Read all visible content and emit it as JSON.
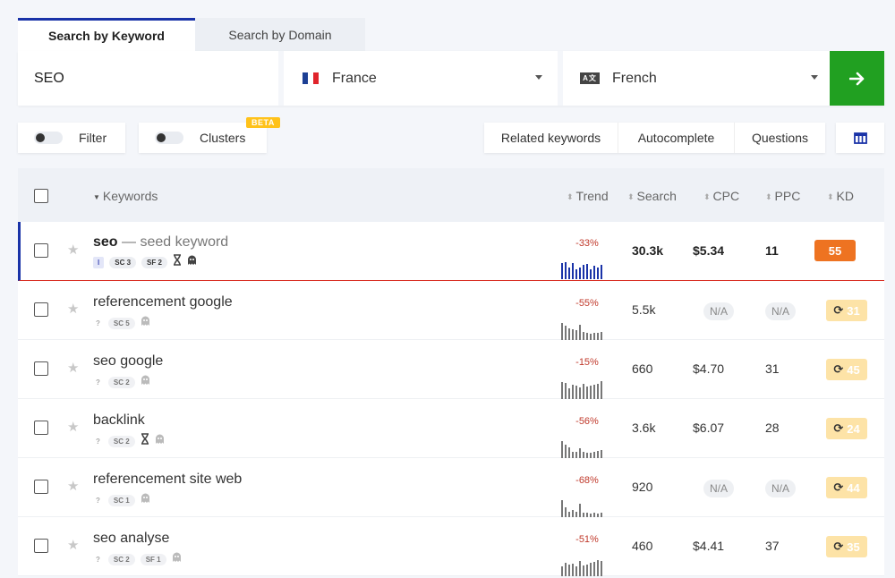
{
  "tabs": [
    {
      "label": "Search by Keyword",
      "active": true
    },
    {
      "label": "Search by Domain",
      "active": false
    }
  ],
  "search": {
    "value": "SEO",
    "country": "France",
    "language": "French",
    "lang_icon_text": "A文",
    "go_icon": "arrow-right-icon"
  },
  "controls": {
    "filter_label": "Filter",
    "clusters_label": "Clusters",
    "beta_badge": "BETA",
    "modes": [
      "Related keywords",
      "Autocomplete",
      "Questions"
    ],
    "columns_icon": "columns-icon"
  },
  "table": {
    "headers": {
      "keywords": "Keywords",
      "trend": "Trend",
      "search": "Search",
      "cpc": "CPC",
      "ppc": "PPC",
      "kd": "KD"
    },
    "rows": [
      {
        "keyword": "seo",
        "seed_label": "— seed keyword",
        "intent": "I",
        "tags": [
          "SC 3",
          "SF 2"
        ],
        "hourglass": true,
        "ghost": true,
        "trend_pct": "-33%",
        "trend": [
          0.85,
          0.9,
          0.6,
          0.85,
          0.5,
          0.6,
          0.75,
          0.8,
          0.5,
          0.7,
          0.6,
          0.75
        ],
        "search": "30.3k",
        "cpc": "$5.34",
        "ppc": "11",
        "kd": "55"
      },
      {
        "keyword": "referencement google",
        "intent": "?",
        "tags": [
          "SC 5"
        ],
        "hourglass": false,
        "ghost": true,
        "trend_pct": "-55%",
        "trend": [
          0.9,
          0.75,
          0.6,
          0.55,
          0.5,
          0.8,
          0.45,
          0.4,
          0.35,
          0.4,
          0.4,
          0.45
        ],
        "search": "5.5k",
        "cpc": "N/A",
        "ppc": "N/A",
        "kd": "31"
      },
      {
        "keyword": "seo google",
        "intent": "?",
        "tags": [
          "SC 2"
        ],
        "hourglass": false,
        "ghost": true,
        "trend_pct": "-15%",
        "trend": [
          0.9,
          0.85,
          0.55,
          0.75,
          0.7,
          0.6,
          0.8,
          0.65,
          0.7,
          0.75,
          0.8,
          0.95
        ],
        "search": "660",
        "cpc": "$4.70",
        "ppc": "31",
        "kd": "45"
      },
      {
        "keyword": "backlink",
        "intent": "?",
        "tags": [
          "SC 2"
        ],
        "hourglass": true,
        "ghost": true,
        "trend_pct": "-56%",
        "trend": [
          0.9,
          0.7,
          0.55,
          0.35,
          0.35,
          0.5,
          0.35,
          0.3,
          0.3,
          0.35,
          0.4,
          0.45
        ],
        "search": "3.6k",
        "cpc": "$6.07",
        "ppc": "28",
        "kd": "24"
      },
      {
        "keyword": "referencement site web",
        "intent": "?",
        "tags": [
          "SC 1"
        ],
        "hourglass": false,
        "ghost": true,
        "trend_pct": "-68%",
        "trend": [
          0.9,
          0.5,
          0.3,
          0.4,
          0.3,
          0.7,
          0.25,
          0.25,
          0.2,
          0.25,
          0.2,
          0.25
        ],
        "search": "920",
        "cpc": "N/A",
        "ppc": "N/A",
        "kd": "44"
      },
      {
        "keyword": "seo analyse",
        "intent": "?",
        "tags": [
          "SC 2",
          "SF 1"
        ],
        "hourglass": false,
        "ghost": true,
        "trend_pct": "-51%",
        "trend": [
          0.5,
          0.7,
          0.6,
          0.65,
          0.5,
          0.8,
          0.55,
          0.6,
          0.7,
          0.75,
          0.85,
          0.8
        ],
        "search": "460",
        "cpc": "$4.41",
        "ppc": "37",
        "kd": "35"
      }
    ]
  },
  "colors": {
    "accent": "#1a33a8",
    "go": "#21a021",
    "kd_full": "#ee7321",
    "kd_pale": "#fde3a7",
    "beta": "#ffc21a"
  }
}
